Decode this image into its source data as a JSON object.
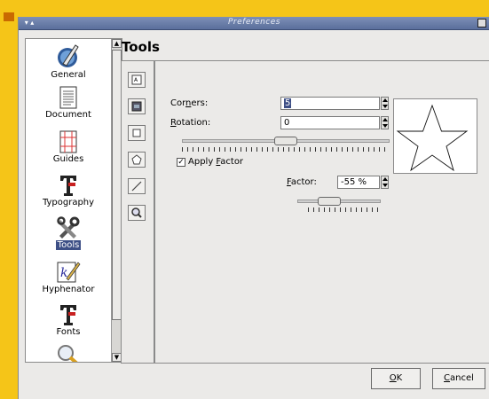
{
  "window": {
    "title": "Preferences",
    "title_bar_left": "▾ ▴"
  },
  "sidebar": {
    "items": [
      {
        "label": "General",
        "icon": "general-icon"
      },
      {
        "label": "Document",
        "icon": "document-icon"
      },
      {
        "label": "Guides",
        "icon": "guides-icon"
      },
      {
        "label": "Typography",
        "icon": "typography-icon"
      },
      {
        "label": "Tools",
        "icon": "tools-icon",
        "selected": true
      },
      {
        "label": "Hyphenator",
        "icon": "hyphenator-icon"
      },
      {
        "label": "Fonts",
        "icon": "fonts-icon"
      }
    ]
  },
  "page": {
    "heading": "Tools"
  },
  "tools": [
    {
      "name": "text-frame-tool"
    },
    {
      "name": "image-frame-tool"
    },
    {
      "name": "rectangle-tool"
    },
    {
      "name": "polygon-tool"
    },
    {
      "name": "line-tool"
    },
    {
      "name": "zoom-tool"
    }
  ],
  "polygon": {
    "corners_label_pre": "Cor",
    "corners_label_u": "n",
    "corners_label_post": "ers:",
    "corners_value": "5",
    "rotation_label_u": "R",
    "rotation_label_post": "otation:",
    "rotation_value": "0",
    "apply_factor_check": "✓",
    "apply_factor_pre": "Apply ",
    "apply_factor_u": "F",
    "apply_factor_post": "actor",
    "apply_factor_checked": true,
    "factor_label_u": "F",
    "factor_label_post": "actor:",
    "factor_value": "-55 %"
  },
  "buttons": {
    "ok_u": "O",
    "ok_post": "K",
    "cancel_u": "C",
    "cancel_post": "ancel"
  }
}
